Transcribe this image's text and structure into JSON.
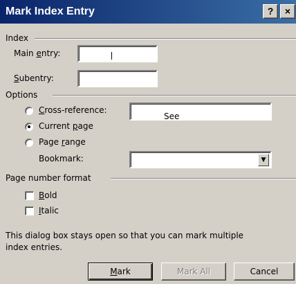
{
  "window": {
    "title": "Mark Index Entry",
    "help_button": "?",
    "close_button": "×"
  },
  "index_group": {
    "label": "Index",
    "main_entry": {
      "label_pre": "Main ",
      "label_key": "e",
      "label_post": "ntry:",
      "value": ""
    },
    "subentry": {
      "label_key": "S",
      "label_post": "ubentry:",
      "value": ""
    }
  },
  "options_group": {
    "label": "Options",
    "cross_reference": {
      "label_key": "C",
      "label_post": "ross-reference:",
      "value": "See",
      "selected": false
    },
    "current_page": {
      "label_pre": "Current ",
      "label_key": "p",
      "label_post": "age",
      "selected": true
    },
    "page_range": {
      "label_pre": "Page ",
      "label_key": "r",
      "label_post": "ange",
      "selected": false
    },
    "bookmark": {
      "label": "Bookmark:",
      "value": ""
    }
  },
  "page_number_format": {
    "label": "Page number format",
    "bold": {
      "label_key": "B",
      "label_post": "old",
      "checked": false
    },
    "italic": {
      "label_key": "I",
      "label_post": "talic",
      "checked": false
    }
  },
  "info_text_line1": "This dialog box stays open so that you can mark multiple",
  "info_text_line2": "index entries.",
  "buttons": {
    "mark": {
      "label_key": "M",
      "label_post": "ark"
    },
    "mark_all": {
      "label": "Mark All"
    },
    "cancel": {
      "label": "Cancel"
    }
  }
}
